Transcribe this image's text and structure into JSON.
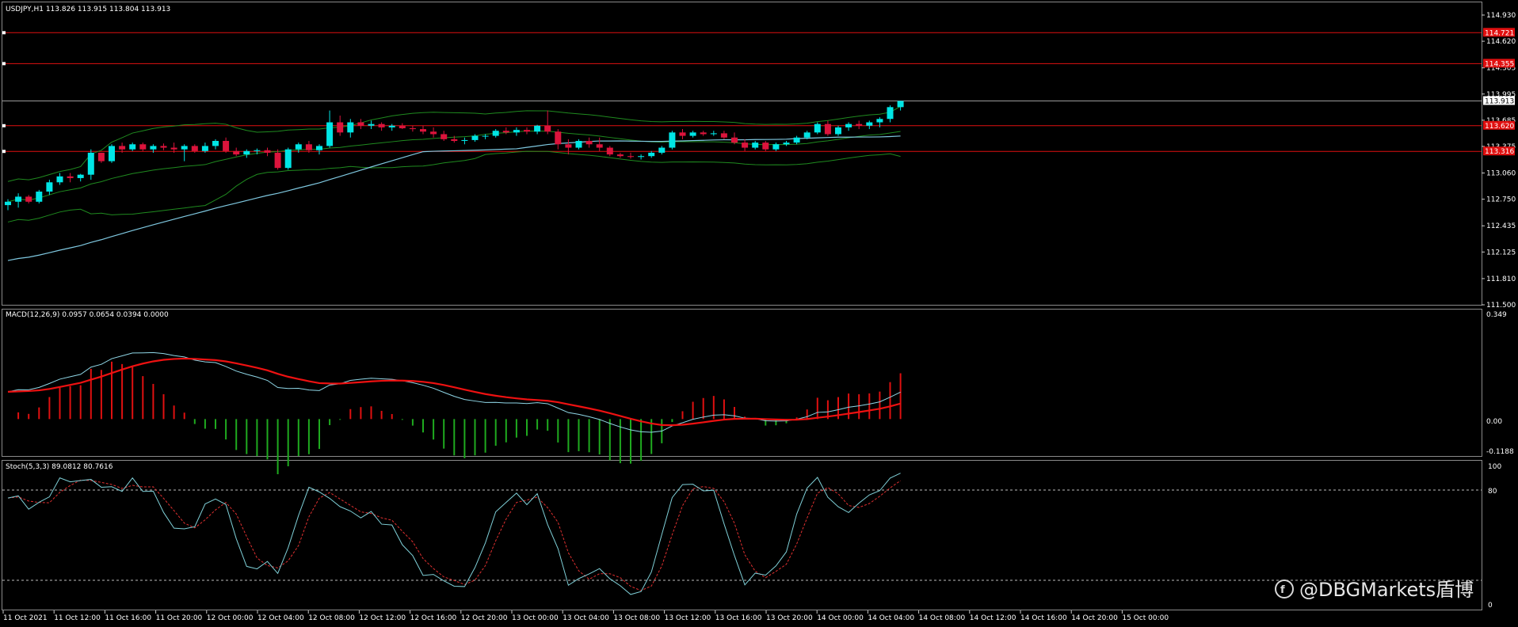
{
  "colors": {
    "background": "#000000",
    "bull": "#00e5e5",
    "bear": "#dc143c",
    "level": "#e01010",
    "bollinger": "#1f8a1f",
    "ma": "#7fc8e0",
    "macd_line": "#8fd6e6",
    "signal": "#ee1111",
    "hist_pos": "#e01010",
    "hist_neg": "#1faa1f",
    "stoch_main": "#7fd0d8",
    "stoch_signal": "#e03030",
    "bid_line": "#9a9a9a",
    "grid": "#ffffff"
  },
  "main_panel": {
    "header": "USDJPY,H1  113.826 113.915 113.804 113.913",
    "price_ticks": [
      "114.930",
      "114.620",
      "114.305",
      "113.995",
      "113.685",
      "113.375",
      "113.060",
      "112.750",
      "112.435",
      "112.125",
      "111.810",
      "111.500"
    ],
    "bid_tag": "113.913",
    "level_tags": [
      "114.721",
      "114.355",
      "113.620",
      "113.316"
    ]
  },
  "macd_panel": {
    "header": "MACD(12,26,9) 0.0957 0.0654 0.0394 0.0000",
    "ticks": [
      "0.349",
      "0.00",
      "-0.1188"
    ]
  },
  "stoch_panel": {
    "header": "Stoch(5,3,3) 89.0812 80.7616",
    "ticks": [
      "100",
      "80",
      "0"
    ]
  },
  "time_axis": [
    "11 Oct 2021",
    "11 Oct 12:00",
    "11 Oct 16:00",
    "11 Oct 20:00",
    "12 Oct 00:00",
    "12 Oct 04:00",
    "12 Oct 08:00",
    "12 Oct 12:00",
    "12 Oct 16:00",
    "12 Oct 20:00",
    "13 Oct 00:00",
    "13 Oct 04:00",
    "13 Oct 08:00",
    "13 Oct 12:00",
    "13 Oct 16:00",
    "13 Oct 20:00",
    "14 Oct 00:00",
    "14 Oct 04:00",
    "14 Oct 08:00",
    "14 Oct 12:00",
    "14 Oct 16:00",
    "14 Oct 20:00",
    "15 Oct 00:00"
  ],
  "watermark": "@DBGMarkets盾博",
  "chart_data": {
    "type": "candlestick",
    "symbol": "USDJPY",
    "timeframe": "H1",
    "y_range": [
      111.5,
      115.08
    ],
    "horizontal_levels": [
      114.721,
      114.355,
      113.62,
      113.316
    ],
    "last_price": 113.913,
    "candles": [
      [
        112.68,
        112.75,
        112.62,
        112.72
      ],
      [
        112.72,
        112.82,
        112.65,
        112.78
      ],
      [
        112.78,
        112.8,
        112.7,
        112.72
      ],
      [
        112.72,
        112.86,
        112.7,
        112.84
      ],
      [
        112.84,
        112.98,
        112.8,
        112.95
      ],
      [
        112.95,
        113.06,
        112.92,
        113.02
      ],
      [
        113.02,
        113.06,
        112.95,
        113.0
      ],
      [
        113.0,
        113.05,
        112.96,
        113.04
      ],
      [
        113.04,
        113.34,
        112.98,
        113.3
      ],
      [
        113.3,
        113.3,
        113.18,
        113.2
      ],
      [
        113.2,
        113.4,
        113.18,
        113.38
      ],
      [
        113.38,
        113.42,
        113.3,
        113.34
      ],
      [
        113.34,
        113.42,
        113.32,
        113.4
      ],
      [
        113.4,
        113.42,
        113.32,
        113.34
      ],
      [
        113.34,
        113.4,
        113.3,
        113.38
      ],
      [
        113.38,
        113.41,
        113.33,
        113.36
      ],
      [
        113.36,
        113.42,
        113.3,
        113.34
      ],
      [
        113.34,
        113.4,
        113.2,
        113.38
      ],
      [
        113.38,
        113.4,
        113.3,
        113.32
      ],
      [
        113.32,
        113.42,
        113.3,
        113.38
      ],
      [
        113.38,
        113.46,
        113.34,
        113.44
      ],
      [
        113.44,
        113.48,
        113.3,
        113.32
      ],
      [
        113.32,
        113.36,
        113.26,
        113.28
      ],
      [
        113.28,
        113.34,
        113.24,
        113.32
      ],
      [
        113.32,
        113.35,
        113.28,
        113.33
      ],
      [
        113.33,
        113.36,
        113.26,
        113.3
      ],
      [
        113.3,
        113.34,
        113.1,
        113.12
      ],
      [
        113.12,
        113.36,
        113.1,
        113.34
      ],
      [
        113.34,
        113.42,
        113.3,
        113.4
      ],
      [
        113.4,
        113.44,
        113.3,
        113.33
      ],
      [
        113.33,
        113.4,
        113.28,
        113.38
      ],
      [
        113.38,
        113.8,
        113.36,
        113.66
      ],
      [
        113.66,
        113.74,
        113.5,
        113.54
      ],
      [
        113.54,
        113.7,
        113.48,
        113.66
      ],
      [
        113.66,
        113.7,
        113.58,
        113.62
      ],
      [
        113.62,
        113.68,
        113.58,
        113.64
      ],
      [
        113.64,
        113.66,
        113.56,
        113.6
      ],
      [
        113.6,
        113.64,
        113.56,
        113.62
      ],
      [
        113.62,
        113.65,
        113.58,
        113.59
      ],
      [
        113.59,
        113.62,
        113.55,
        113.58
      ],
      [
        113.58,
        113.62,
        113.52,
        113.55
      ],
      [
        113.55,
        113.6,
        113.48,
        113.52
      ],
      [
        113.52,
        113.56,
        113.44,
        113.46
      ],
      [
        113.46,
        113.5,
        113.42,
        113.44
      ],
      [
        113.44,
        113.48,
        113.4,
        113.45
      ],
      [
        113.45,
        113.52,
        113.43,
        113.5
      ],
      [
        113.5,
        113.52,
        113.46,
        113.5
      ],
      [
        113.5,
        113.58,
        113.48,
        113.56
      ],
      [
        113.56,
        113.6,
        113.52,
        113.54
      ],
      [
        113.54,
        113.6,
        113.5,
        113.57
      ],
      [
        113.57,
        113.6,
        113.52,
        113.55
      ],
      [
        113.55,
        113.63,
        113.52,
        113.62
      ],
      [
        113.62,
        113.8,
        113.52,
        113.55
      ],
      [
        113.55,
        113.58,
        113.34,
        113.4
      ],
      [
        113.4,
        113.46,
        113.28,
        113.36
      ],
      [
        113.36,
        113.46,
        113.34,
        113.44
      ],
      [
        113.44,
        113.48,
        113.36,
        113.4
      ],
      [
        113.4,
        113.48,
        113.32,
        113.36
      ],
      [
        113.36,
        113.38,
        113.26,
        113.28
      ],
      [
        113.28,
        113.3,
        113.24,
        113.26
      ],
      [
        113.26,
        113.3,
        113.23,
        113.25
      ],
      [
        113.25,
        113.28,
        113.22,
        113.26
      ],
      [
        113.26,
        113.32,
        113.24,
        113.3
      ],
      [
        113.3,
        113.38,
        113.28,
        113.36
      ],
      [
        113.36,
        113.56,
        113.34,
        113.54
      ],
      [
        113.54,
        113.58,
        113.46,
        113.5
      ],
      [
        113.5,
        113.56,
        113.48,
        113.54
      ],
      [
        113.54,
        113.56,
        113.5,
        113.52
      ],
      [
        113.52,
        113.56,
        113.5,
        113.53
      ],
      [
        113.53,
        113.56,
        113.46,
        113.48
      ],
      [
        113.48,
        113.54,
        113.4,
        113.42
      ],
      [
        113.42,
        113.46,
        113.32,
        113.36
      ],
      [
        113.36,
        113.44,
        113.34,
        113.42
      ],
      [
        113.42,
        113.44,
        113.32,
        113.34
      ],
      [
        113.34,
        113.42,
        113.32,
        113.4
      ],
      [
        113.4,
        113.44,
        113.38,
        113.42
      ],
      [
        113.42,
        113.5,
        113.4,
        113.48
      ],
      [
        113.48,
        113.56,
        113.46,
        113.54
      ],
      [
        113.54,
        113.66,
        113.52,
        113.64
      ],
      [
        113.64,
        113.68,
        113.5,
        113.52
      ],
      [
        113.52,
        113.62,
        113.5,
        113.6
      ],
      [
        113.6,
        113.66,
        113.56,
        113.64
      ],
      [
        113.64,
        113.68,
        113.58,
        113.62
      ],
      [
        113.62,
        113.68,
        113.58,
        113.66
      ],
      [
        113.66,
        113.72,
        113.6,
        113.7
      ],
      [
        113.7,
        113.86,
        113.66,
        113.84
      ],
      [
        113.84,
        113.915,
        113.8,
        113.913
      ]
    ],
    "indicators": {
      "macd": {
        "params": "12,26,9",
        "values": [
          0.0957,
          0.0654,
          0.0394,
          0.0
        ],
        "y_range": [
          -0.1188,
          0.349
        ]
      },
      "stochastic": {
        "params": "5,3,3",
        "values": [
          89.0812,
          80.7616
        ],
        "y_range": [
          0,
          100
        ],
        "levels": [
          80,
          20
        ]
      }
    }
  }
}
